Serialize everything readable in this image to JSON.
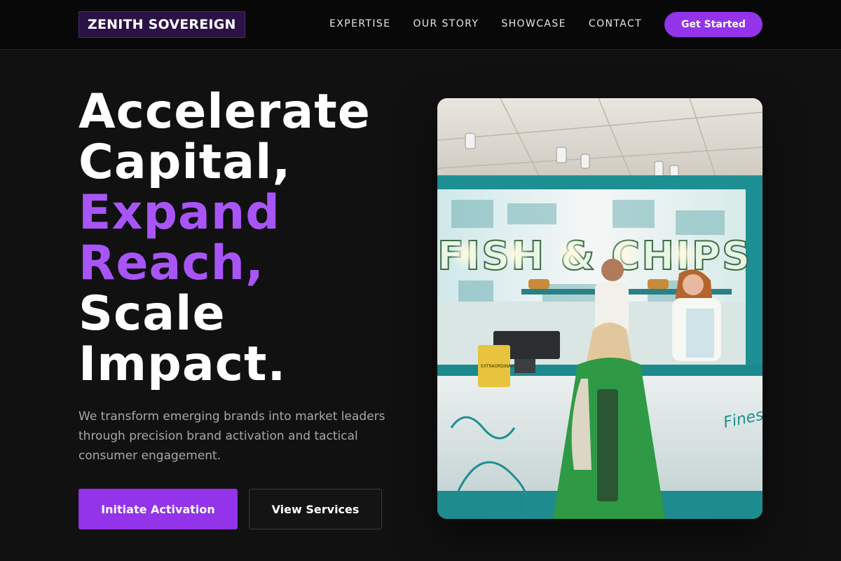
{
  "header": {
    "brand": "ZENITH SOVEREIGN",
    "nav": [
      "EXPERTISE",
      "OUR STORY",
      "SHOWCASE",
      "CONTACT"
    ],
    "cta_label": "Get Started"
  },
  "hero": {
    "title_lines": [
      "Accelerate",
      "Capital,",
      "Expand",
      "Reach,",
      "Scale",
      "Impact."
    ],
    "description": "We transform emerging brands into market leaders through precision brand activation and tactical consumer engagement.",
    "primary_button": "Initiate Activation",
    "secondary_button": "View Services"
  },
  "photo": {
    "sign_text": "FISH & CHIPS",
    "counter_text": "Finest",
    "display_card_text": "EXTRAORDINARY"
  },
  "colors": {
    "accent": "#9333ea",
    "accent_text": "#a855f7",
    "background": "#111111",
    "nav_background": "#080808"
  }
}
